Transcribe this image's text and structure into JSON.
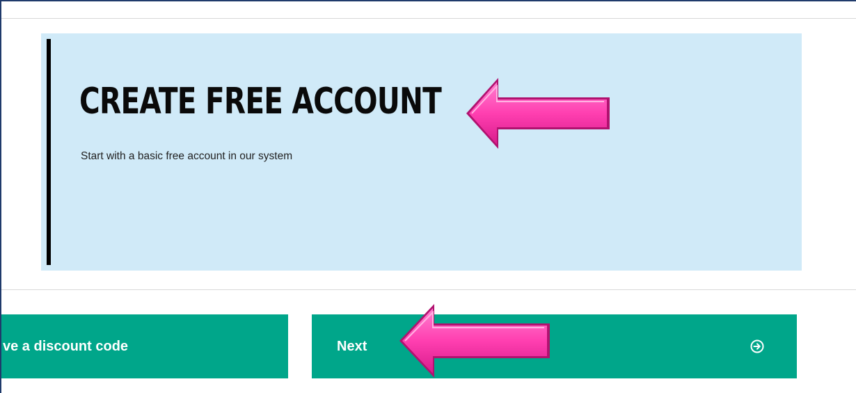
{
  "plan": {
    "title": "CREATE FREE ACCOUNT",
    "description": "Start with a basic free account in our system"
  },
  "buttons": {
    "discount_label": "ve a discount code",
    "next_label": "Next",
    "next_icon": "arrow-circle-right-icon"
  },
  "colors": {
    "card_background": "#d0eaf8",
    "button_green": "#00a68a",
    "annotation_arrow": "#ff3fb0"
  }
}
